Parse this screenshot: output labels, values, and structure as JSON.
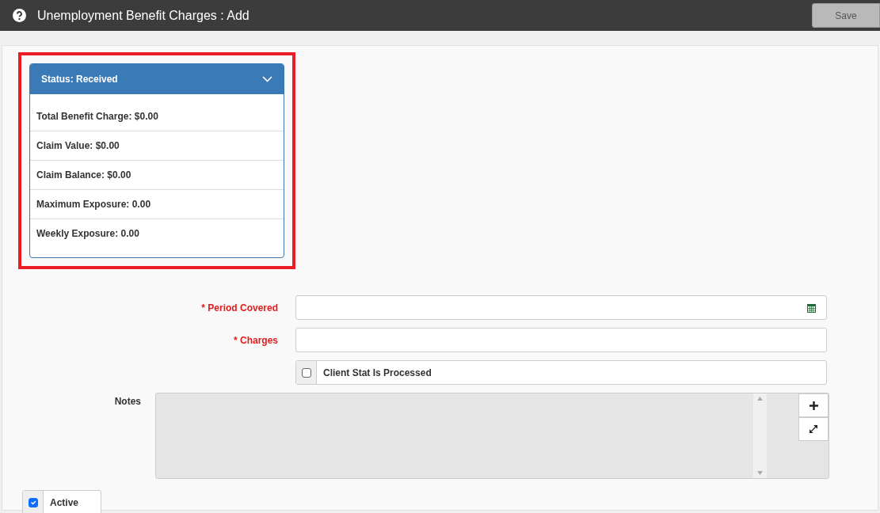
{
  "window": {
    "title": "Unemployment Benefit Charges : Add"
  },
  "save_button": {
    "label": "Save",
    "disabled": true
  },
  "status_card": {
    "title": "Status: Received",
    "expanded": true,
    "highlighted": true,
    "items": [
      "Total Benefit Charge: $0.00",
      "Claim Value: $0.00",
      "Claim Balance: $0.00",
      "Maximum Exposure: 0.00",
      "Weekly Exposure: 0.00"
    ]
  },
  "fields": [
    {
      "kind": "date",
      "label": "* Period Covered",
      "required": true
    },
    {
      "kind": "text",
      "label": "* Charges",
      "required": true
    },
    {
      "kind": "checkbox",
      "label": "Client Stat Is Processed",
      "checked": false
    }
  ],
  "notes": {
    "label": "Notes",
    "disabled": true
  },
  "active": {
    "label": "Active",
    "checked": true
  }
}
